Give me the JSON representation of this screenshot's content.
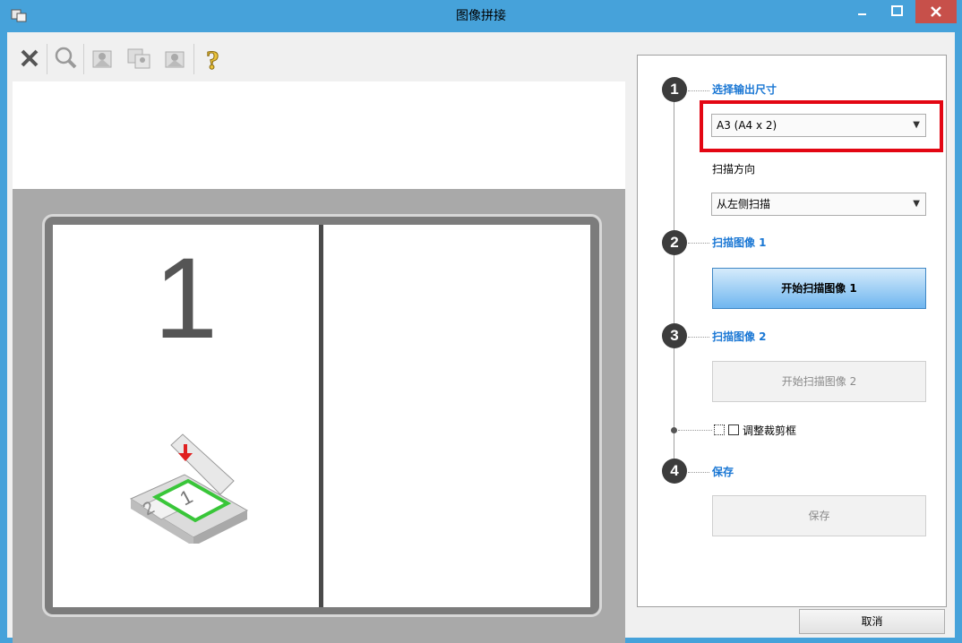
{
  "window": {
    "title": "图像拼接"
  },
  "toolbar": {
    "items": [
      "close-icon",
      "zoom-icon",
      "image-view-icon",
      "image-swap-icon",
      "image-rotate-icon",
      "help-icon"
    ]
  },
  "preview": {
    "left_number": "1"
  },
  "panel": {
    "step1": {
      "number": "1",
      "label": "选择输出尺寸"
    },
    "output_size": {
      "value": "A3 (A4 x 2)"
    },
    "scan_direction_label": "扫描方向",
    "scan_direction": {
      "value": "从左侧扫描"
    },
    "step2": {
      "number": "2",
      "label": "扫描图像 1"
    },
    "start_scan1_label": "开始扫描图像 1",
    "step3": {
      "number": "3",
      "label": "扫描图像 2"
    },
    "start_scan2_label": "开始扫描图像 2",
    "adjust_crop_label": "调整裁剪框",
    "step4": {
      "number": "4",
      "label": "保存"
    },
    "save_label": "保存"
  },
  "footer": {
    "cancel_label": "取消"
  },
  "colors": {
    "titlebar": "#46a2da",
    "step_label": "#1a77d4",
    "highlight": "#e30613",
    "close_button": "#c7504a"
  }
}
